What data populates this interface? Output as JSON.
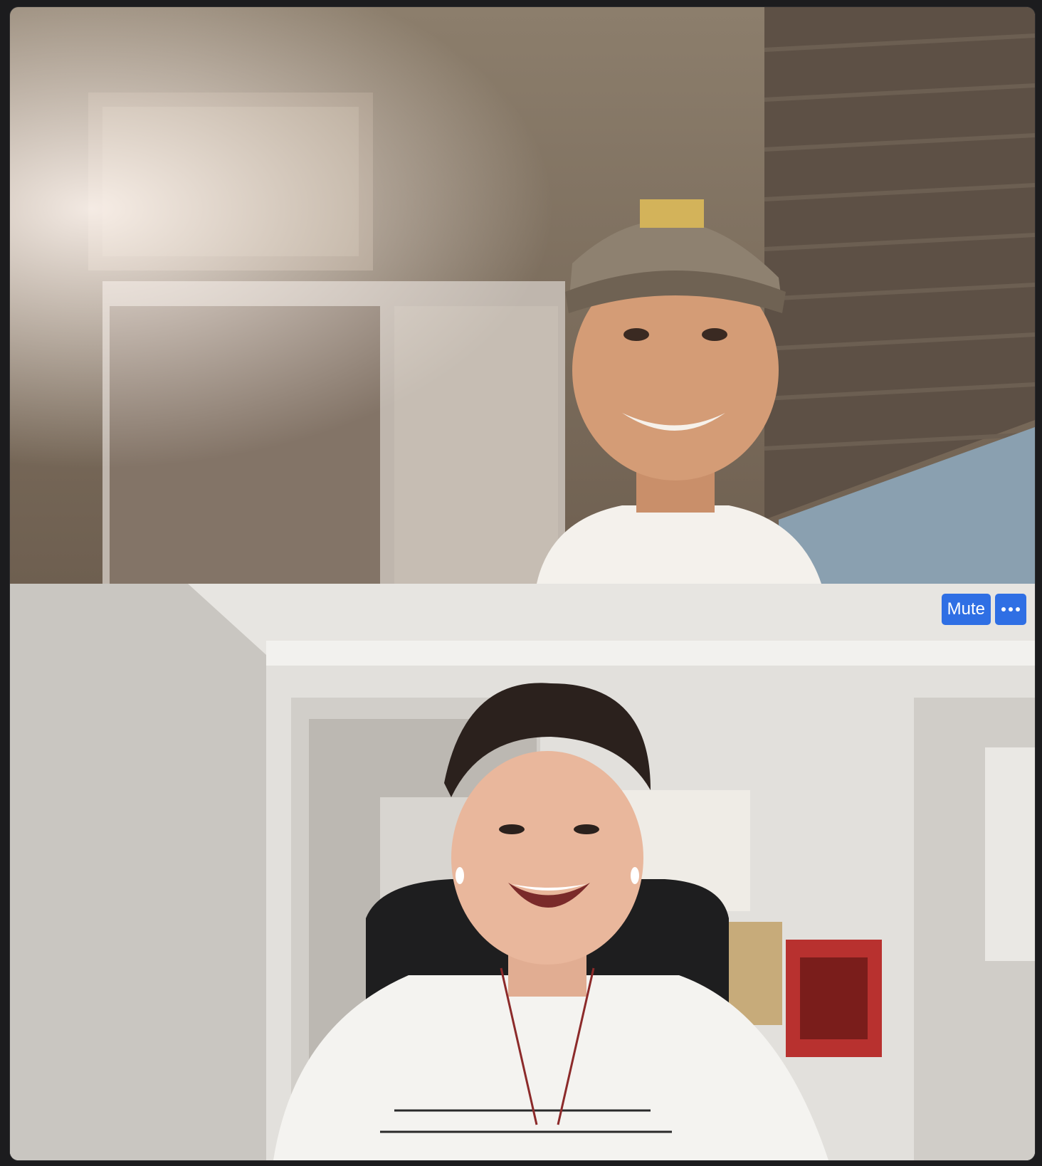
{
  "participants": [
    {
      "id": "remote"
    },
    {
      "id": "self"
    }
  ],
  "self_controls": {
    "mute_label": "Mute",
    "more_icon": "more-horizontal-icon"
  },
  "colors": {
    "button_blue": "#2f6fe4",
    "window_bg": "#1c1c1e"
  }
}
